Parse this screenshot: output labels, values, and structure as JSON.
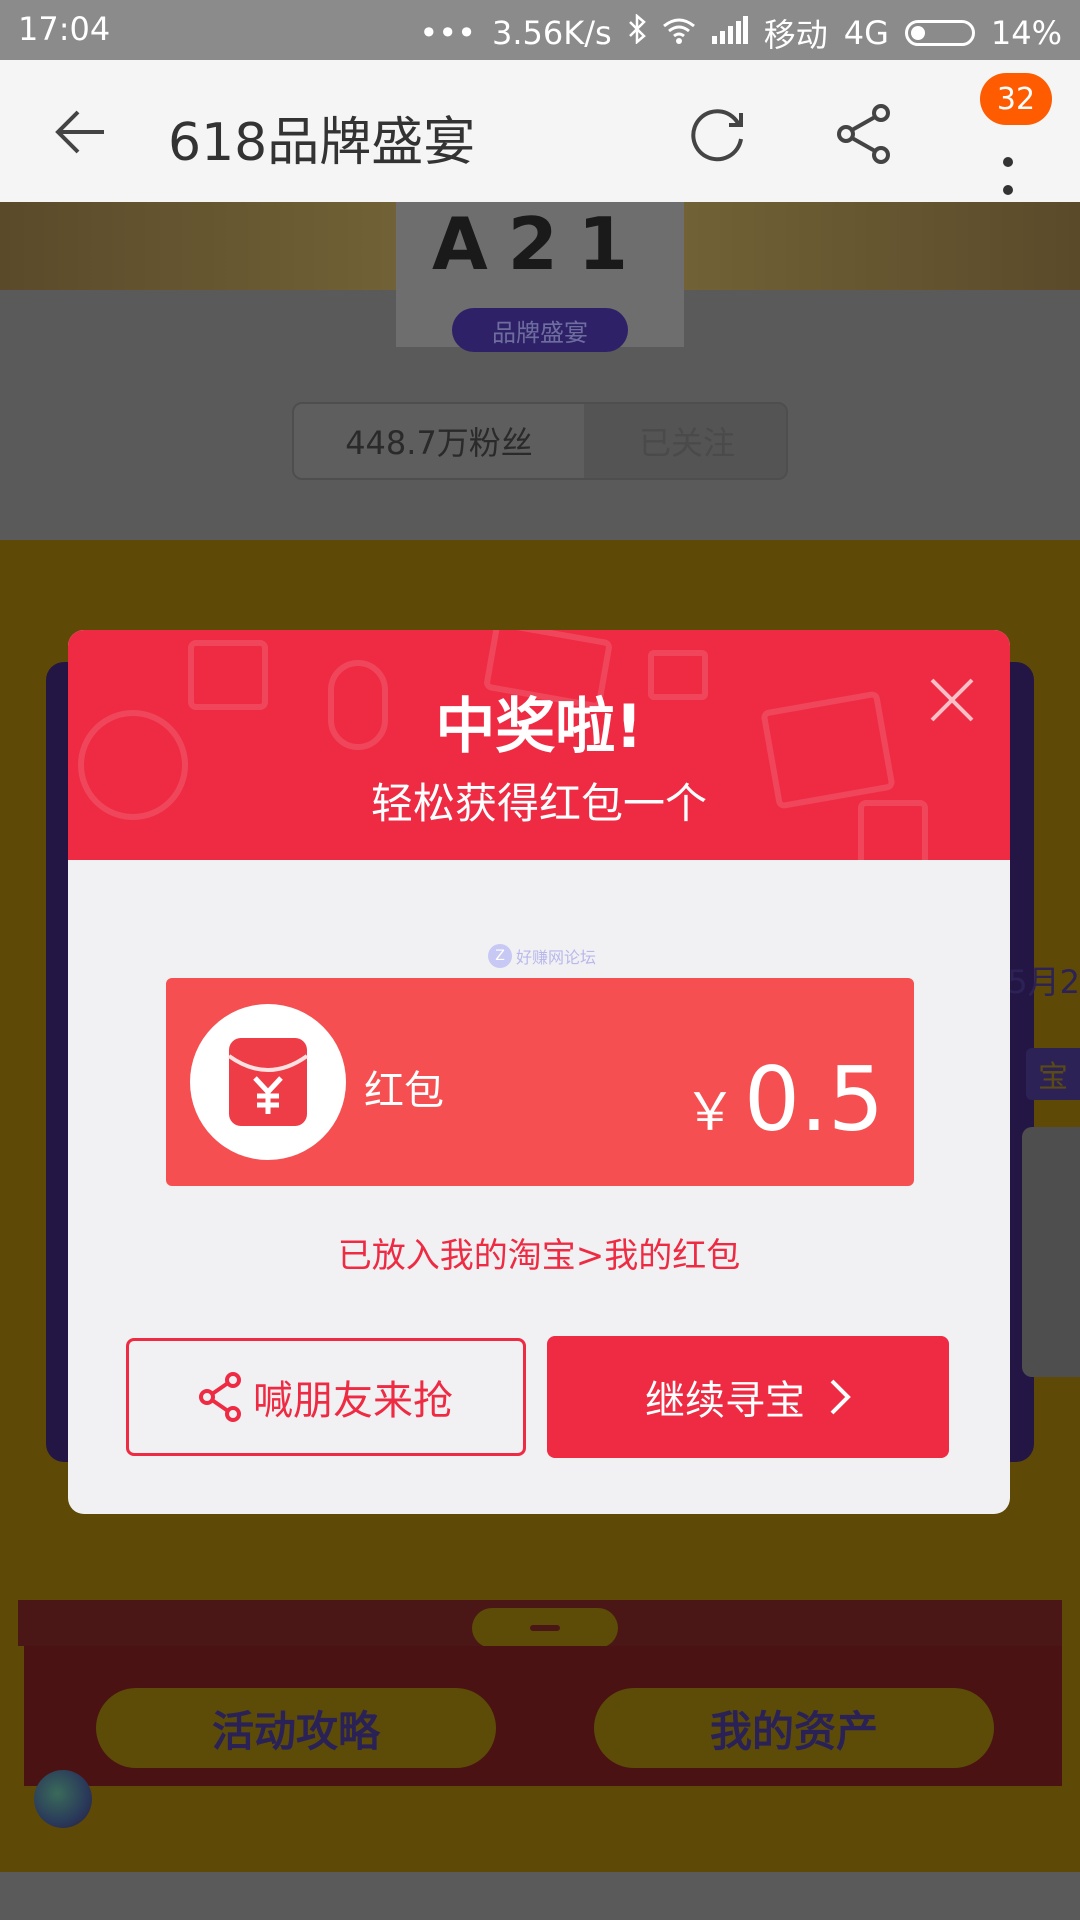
{
  "status_bar": {
    "time": "17:04",
    "network_speed": "3.56K/s",
    "carrier": "移动",
    "network_type": "4G",
    "battery": "14%"
  },
  "app_bar": {
    "title": "618品牌盛宴",
    "badge_count": "32"
  },
  "background": {
    "brand_logo_text": "A21",
    "brand_tag": "品牌盛宴",
    "fans_count": "448.7万粉丝",
    "follow_status": "已关注",
    "side_date": "5月2",
    "side_tag": "宝",
    "guide_button": "活动攻略",
    "assets_button": "我的资产"
  },
  "modal": {
    "title": "中奖啦!",
    "subtitle": "轻松获得红包一个",
    "watermark": "好赚网论坛",
    "reward_label": "红包",
    "currency": "￥",
    "amount": "0.5",
    "note": "已放入我的淘宝>我的红包",
    "share_button": "喊朋友来抢",
    "continue_button": "继续寻宝",
    "accent_color": "#ee2b43",
    "card_color": "#f64f51"
  }
}
